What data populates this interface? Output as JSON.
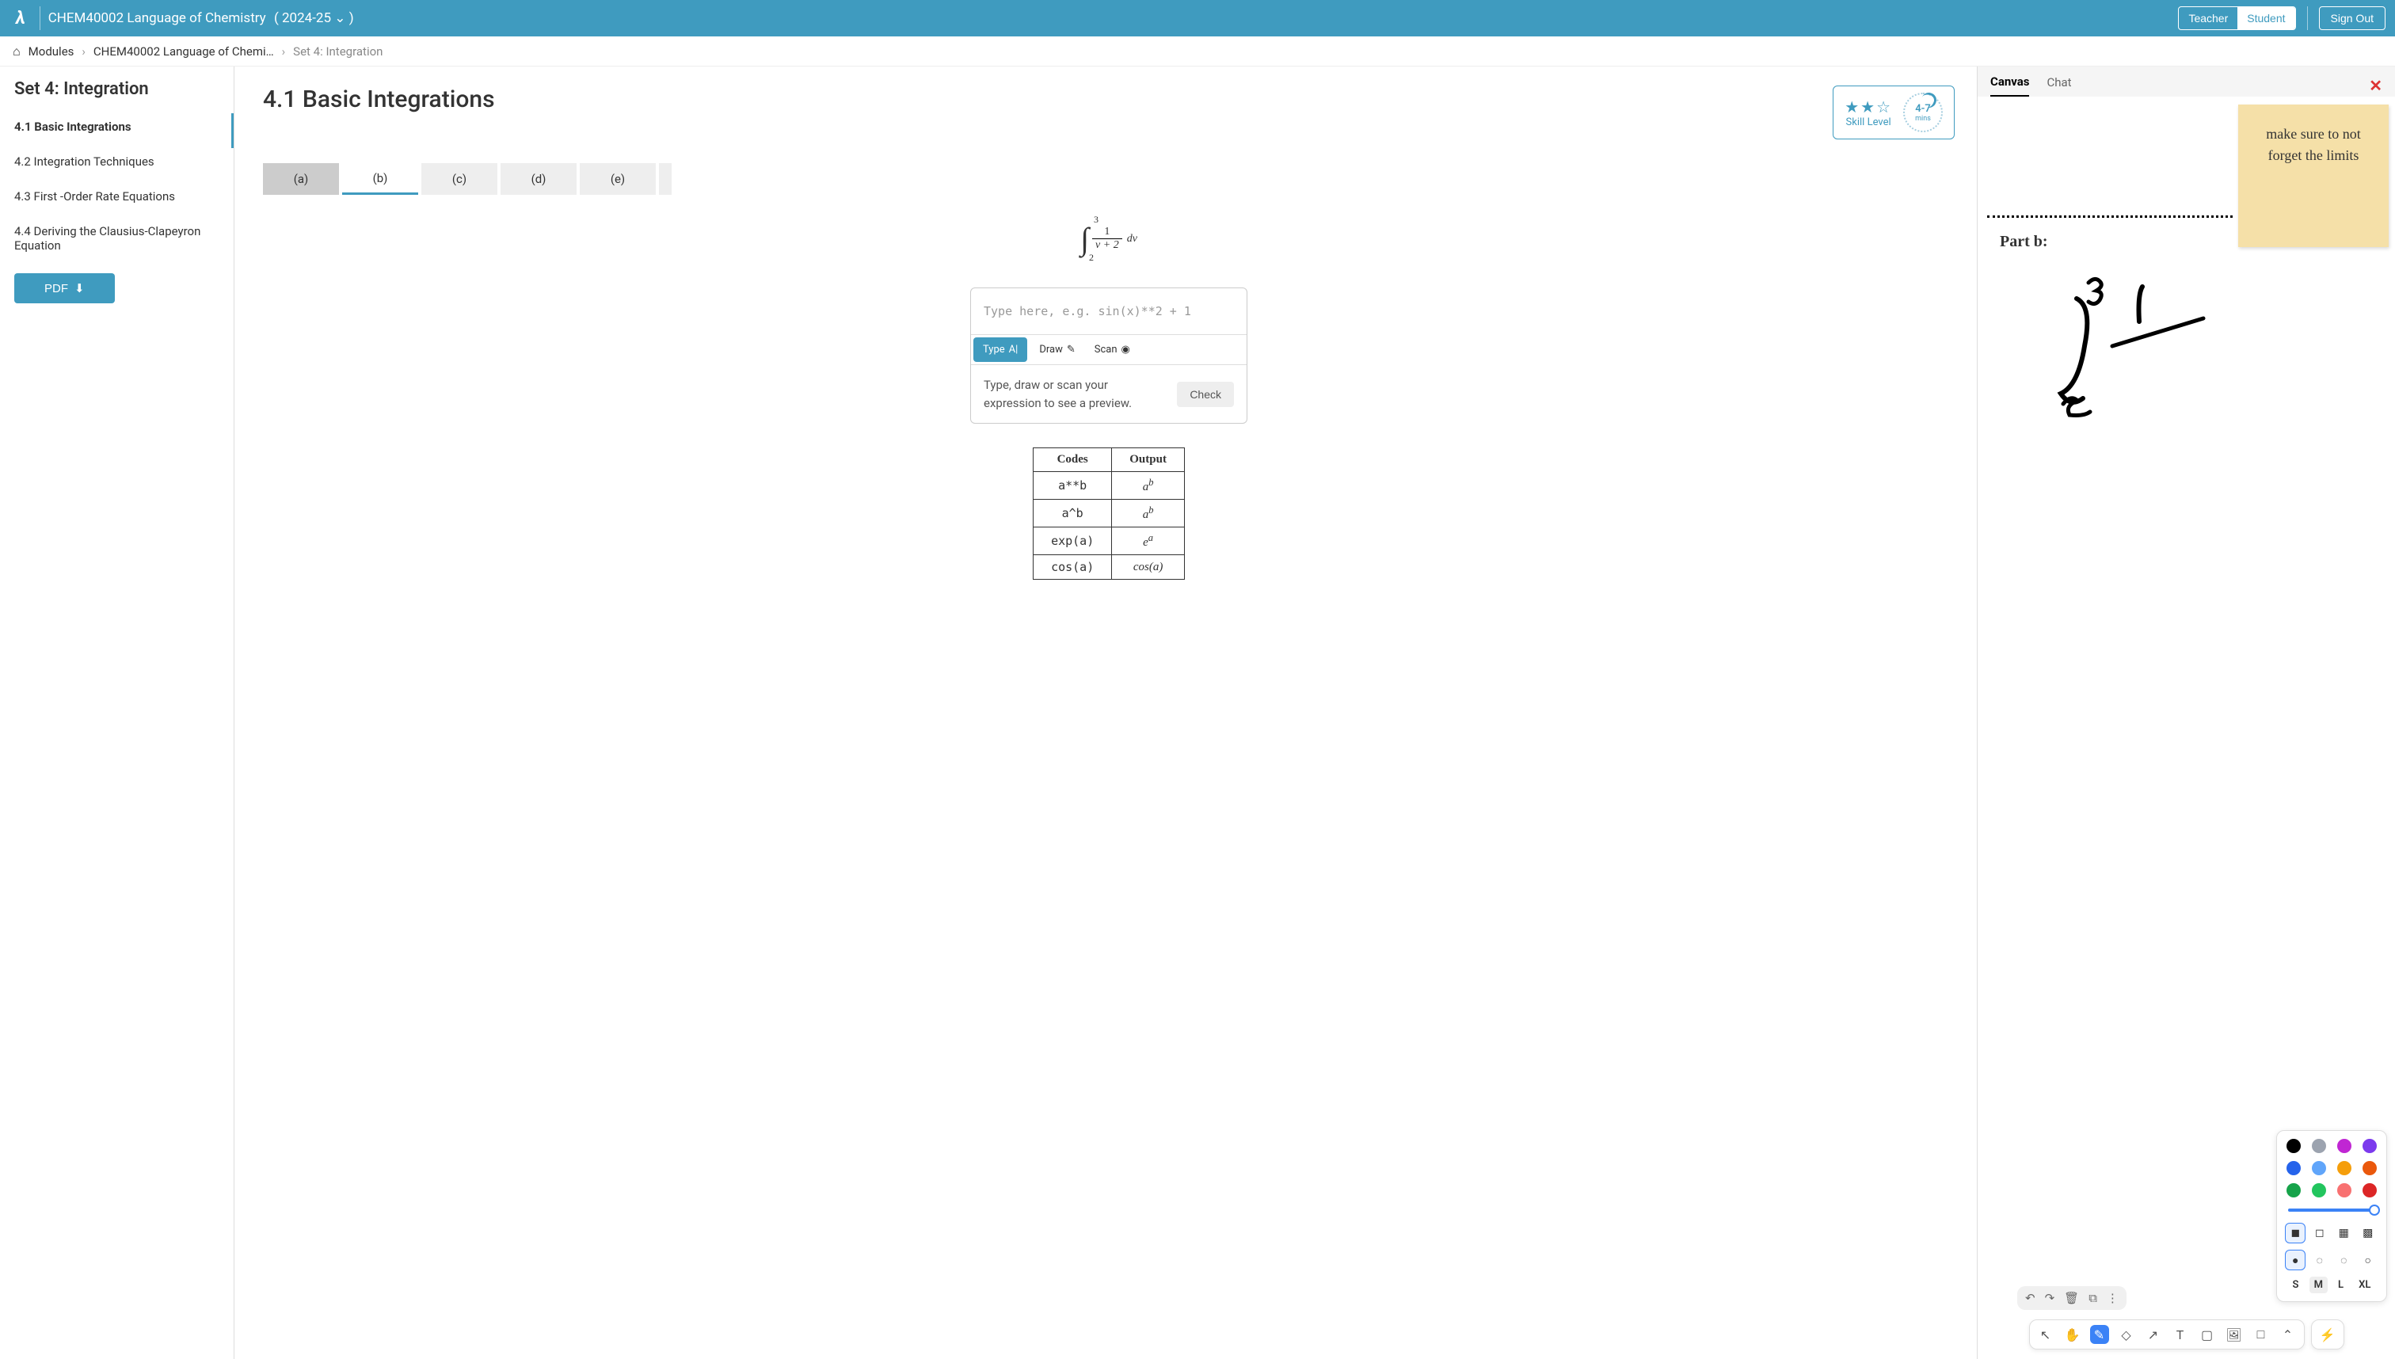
{
  "topbar": {
    "course_code": "CHEM40002 Language of Chemistry",
    "year": "2024-25",
    "role_teacher": "Teacher",
    "role_student": "Student",
    "signout": "Sign Out"
  },
  "breadcrumbs": {
    "home": "Modules",
    "mid": "CHEM40002 Language of Chemi…",
    "current": "Set 4: Integration"
  },
  "sidebar": {
    "title": "Set 4: Integration",
    "items": [
      {
        "label": "4.1 Basic Integrations",
        "active": true
      },
      {
        "label": "4.2 Integration Techniques"
      },
      {
        "label": "4.3 First -Order Rate Equations"
      },
      {
        "label": "4.4 Deriving the Clausius-Clapeyron Equation"
      }
    ],
    "pdf_label": "PDF"
  },
  "content": {
    "title": "4.1 Basic Integrations",
    "skill_label": "Skill Level",
    "skill_stars_filled": 2,
    "skill_stars_total": 3,
    "time_est": "4-7",
    "time_unit": "mins",
    "tabs": [
      "(a)",
      "(b)",
      "(c)",
      "(d)",
      "(e)"
    ],
    "active_tab": 1,
    "integral": {
      "upper": "3",
      "lower": "2",
      "numerator": "1",
      "denominator": "v + 2",
      "dv": "dv"
    },
    "answer": {
      "placeholder": "Type here, e.g. sin(x)**2 + 1",
      "tab_type": "Type",
      "tab_draw": "Draw",
      "tab_scan": "Scan",
      "preview_text": "Type, draw or scan your expression to see a preview.",
      "check": "Check"
    },
    "codes_table": {
      "head_codes": "Codes",
      "head_output": "Output",
      "rows": [
        {
          "code": "a**b",
          "out": "a",
          "sup": "b"
        },
        {
          "code": "a^b",
          "out": "a",
          "sup": "b"
        },
        {
          "code": "exp(a)",
          "out": "e",
          "sup": "a"
        },
        {
          "code": "cos(a)",
          "out": "cos(a)"
        }
      ]
    }
  },
  "canvas": {
    "tab_canvas": "Canvas",
    "tab_chat": "Chat",
    "sticky_text": "make sure to not forget the limits",
    "part_label": "Part b:",
    "sizes": [
      "S",
      "M",
      "L",
      "XL"
    ],
    "active_size": "M",
    "colors": [
      "#000000",
      "#9ca3af",
      "#c026d3",
      "#7c3aed",
      "#2563eb",
      "#60a5fa",
      "#f59e0b",
      "#ea580c",
      "#16a34a",
      "#22c55e",
      "#f87171",
      "#dc2626"
    ]
  }
}
